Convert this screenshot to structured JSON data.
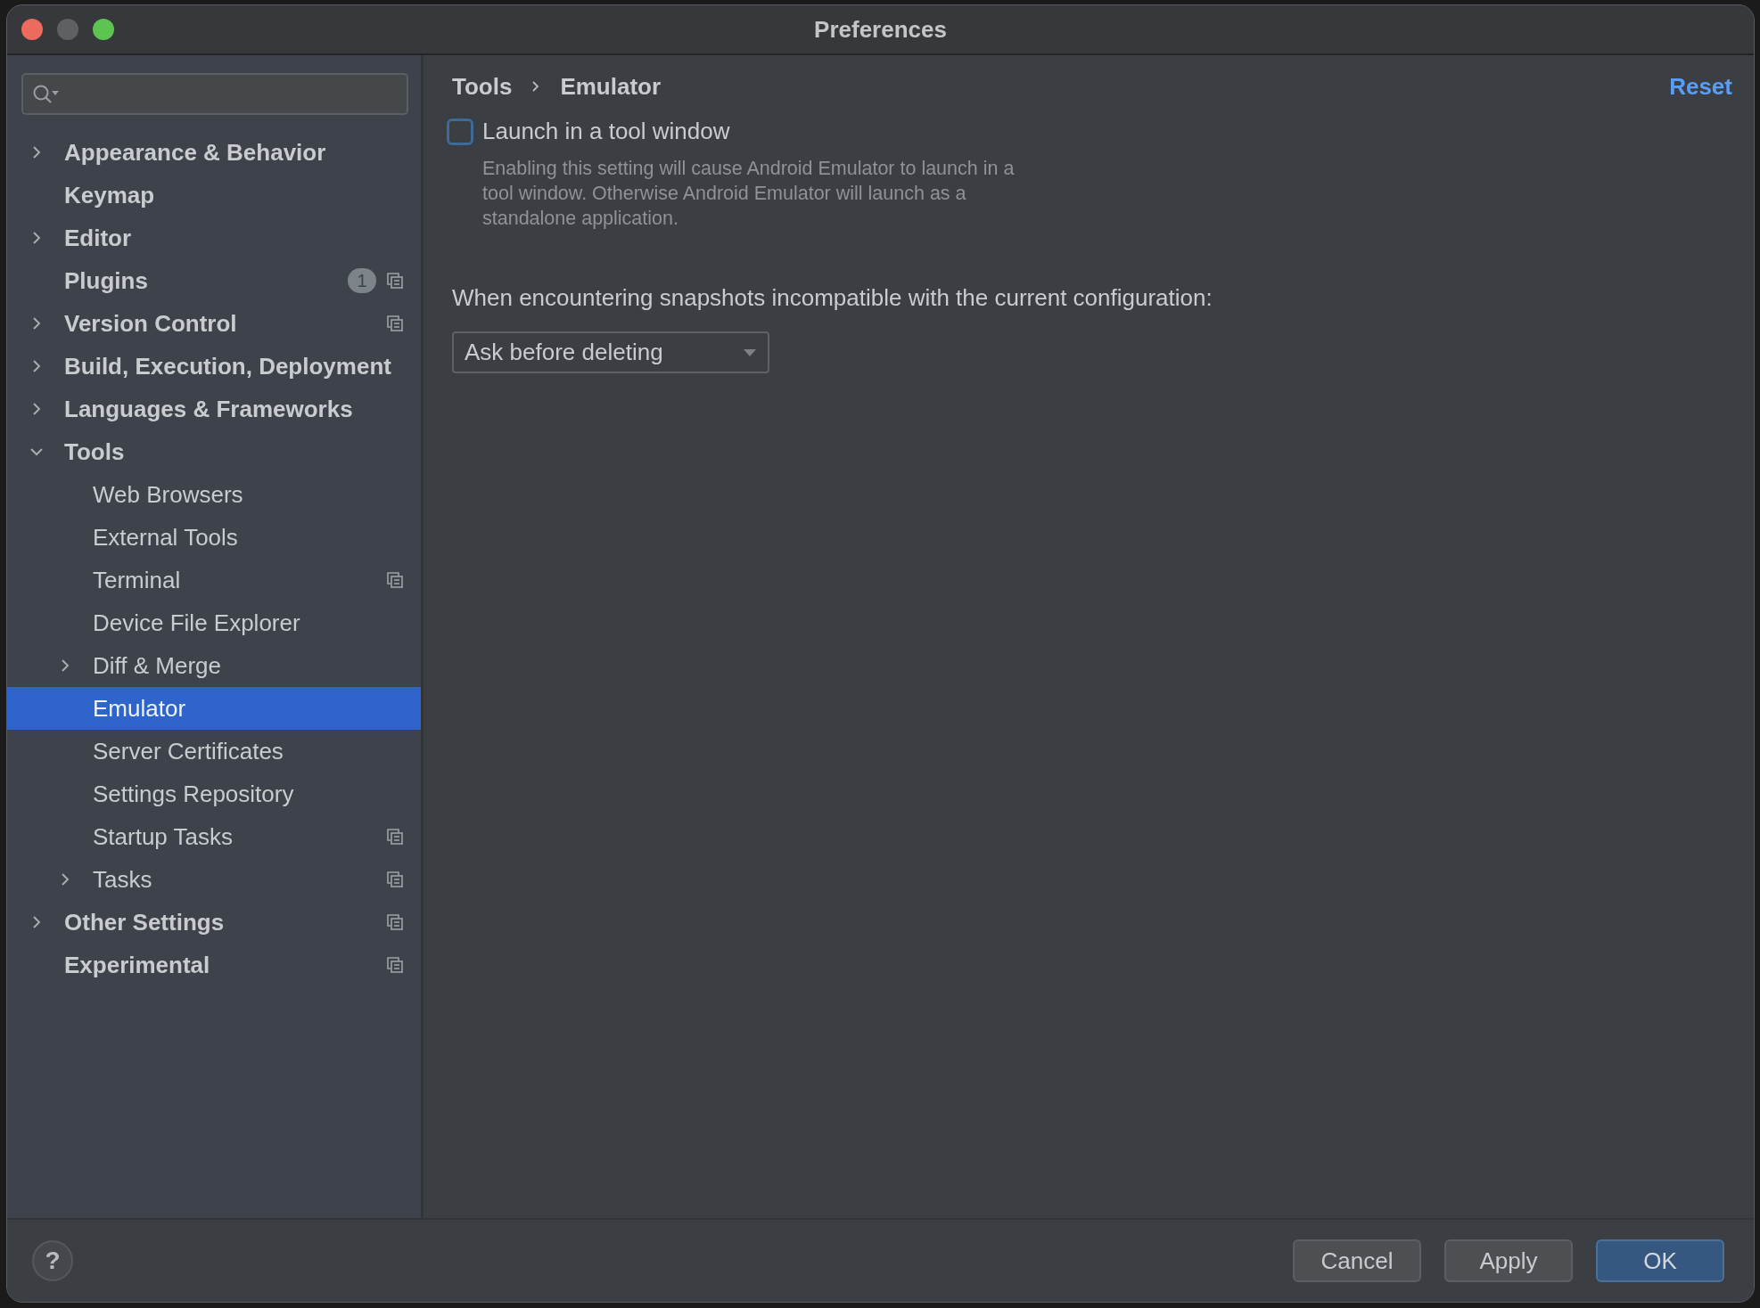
{
  "window": {
    "title": "Preferences"
  },
  "sidebar": {
    "items": [
      {
        "label": "Appearance & Behavior",
        "expanded": false,
        "selected": false,
        "project_level": false
      },
      {
        "label": "Keymap",
        "selected": false,
        "project_level": false
      },
      {
        "label": "Editor",
        "expanded": false,
        "selected": false,
        "project_level": false
      },
      {
        "label": "Plugins",
        "selected": false,
        "project_level": true,
        "badge": "1"
      },
      {
        "label": "Version Control",
        "expanded": false,
        "selected": false,
        "project_level": true
      },
      {
        "label": "Build, Execution, Deployment",
        "expanded": false,
        "selected": false,
        "project_level": false
      },
      {
        "label": "Languages & Frameworks",
        "expanded": false,
        "selected": false,
        "project_level": false
      },
      {
        "label": "Tools",
        "expanded": true,
        "selected": false,
        "project_level": false,
        "children": [
          {
            "label": "Web Browsers",
            "selected": false,
            "project_level": false
          },
          {
            "label": "External Tools",
            "selected": false,
            "project_level": false
          },
          {
            "label": "Terminal",
            "selected": false,
            "project_level": true
          },
          {
            "label": "Device File Explorer",
            "selected": false,
            "project_level": false
          },
          {
            "label": "Diff & Merge",
            "expanded": false,
            "selected": false,
            "project_level": false
          },
          {
            "label": "Emulator",
            "selected": true,
            "project_level": false
          },
          {
            "label": "Server Certificates",
            "selected": false,
            "project_level": false
          },
          {
            "label": "Settings Repository",
            "selected": false,
            "project_level": false
          },
          {
            "label": "Startup Tasks",
            "selected": false,
            "project_level": true
          },
          {
            "label": "Tasks",
            "expanded": false,
            "selected": false,
            "project_level": true
          }
        ]
      },
      {
        "label": "Other Settings",
        "expanded": false,
        "selected": false,
        "project_level": true
      },
      {
        "label": "Experimental",
        "selected": false,
        "project_level": true
      }
    ]
  },
  "breadcrumb": [
    "Tools",
    "Emulator"
  ],
  "reset": "Reset",
  "launch_option": {
    "label": "Launch in a tool window",
    "checked": false,
    "description": "Enabling this setting will cause Android Emulator to launch in a tool window. Otherwise Android Emulator will launch as a standalone application."
  },
  "snapshot_question": "When encountering snapshots incompatible with the current configuration:",
  "snapshot_dropdown": {
    "value": "Ask before deleting"
  },
  "help": "?",
  "buttons": [
    {
      "label": "Cancel",
      "kind": "normal"
    },
    {
      "label": "Apply",
      "kind": "normal"
    },
    {
      "label": "OK",
      "kind": "default"
    }
  ]
}
